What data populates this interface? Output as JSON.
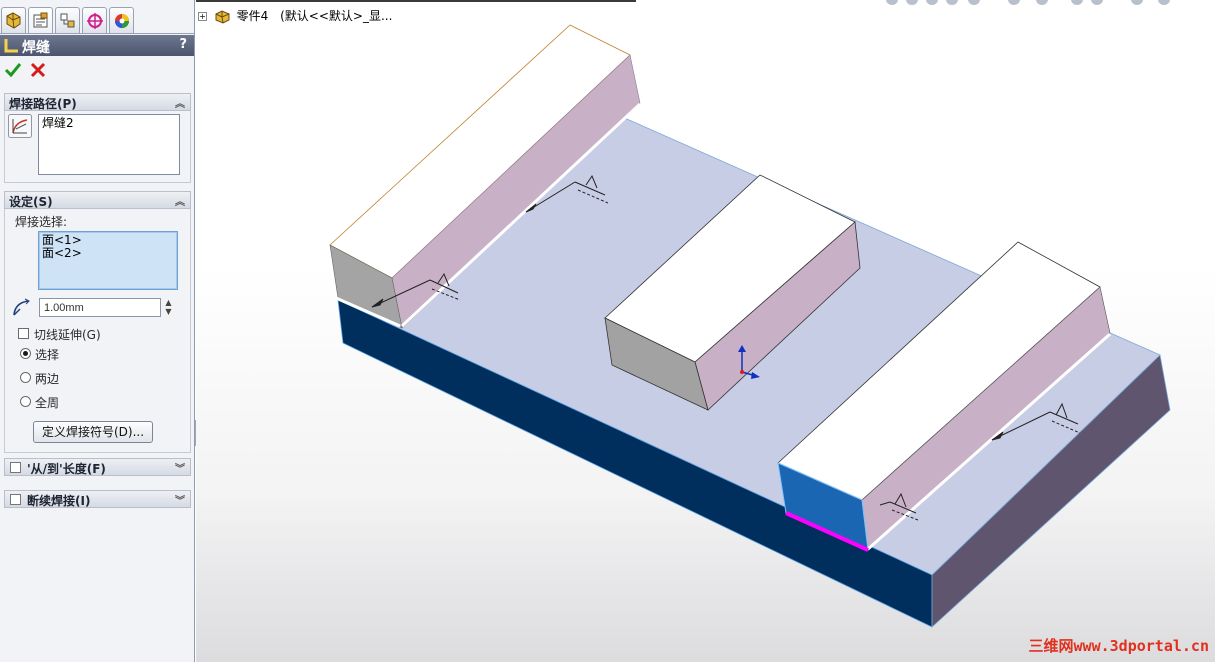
{
  "panel": {
    "tabs": [
      {
        "name": "feature-manager-tab"
      },
      {
        "name": "property-manager-tab"
      },
      {
        "name": "configuration-manager-tab"
      },
      {
        "name": "dimxpert-manager-tab"
      },
      {
        "name": "display-manager-tab"
      }
    ],
    "title": "焊缝",
    "help": "?",
    "groups": {
      "path": {
        "header": "焊接路径(P)",
        "items": [
          "焊缝2"
        ]
      },
      "settings": {
        "header": "设定(S)",
        "selection_label": "焊接选择:",
        "selection_items": [
          "面<1>",
          "面<2>"
        ],
        "size_value": "1.00mm",
        "tangent_label": "切线延伸(G)",
        "radio_options": [
          "选择",
          "两边",
          "全周"
        ],
        "radio_selected": 0,
        "define_button": "定义焊接符号(D)..."
      },
      "from_to": {
        "header": "'从/到'长度(F)"
      },
      "intermittent": {
        "header": "断续焊接(I)"
      }
    }
  },
  "viewport": {
    "tree": {
      "expand": "+",
      "part_name": "零件4",
      "config": "(默认<<默认>_显..."
    },
    "watermark": "三维网www.3dportal.cn"
  },
  "colors": {
    "header_bg": "#5d667e",
    "plate_top": "#c8cde6",
    "plate_front": "#002f5e",
    "plate_side": "#5f556f",
    "block_top": "#ffffff",
    "block_side": "#c8b0c6",
    "block_end": "#a2a2a2",
    "selected_face": "#1a66b3",
    "weld_highlight": "#ff00ff"
  }
}
